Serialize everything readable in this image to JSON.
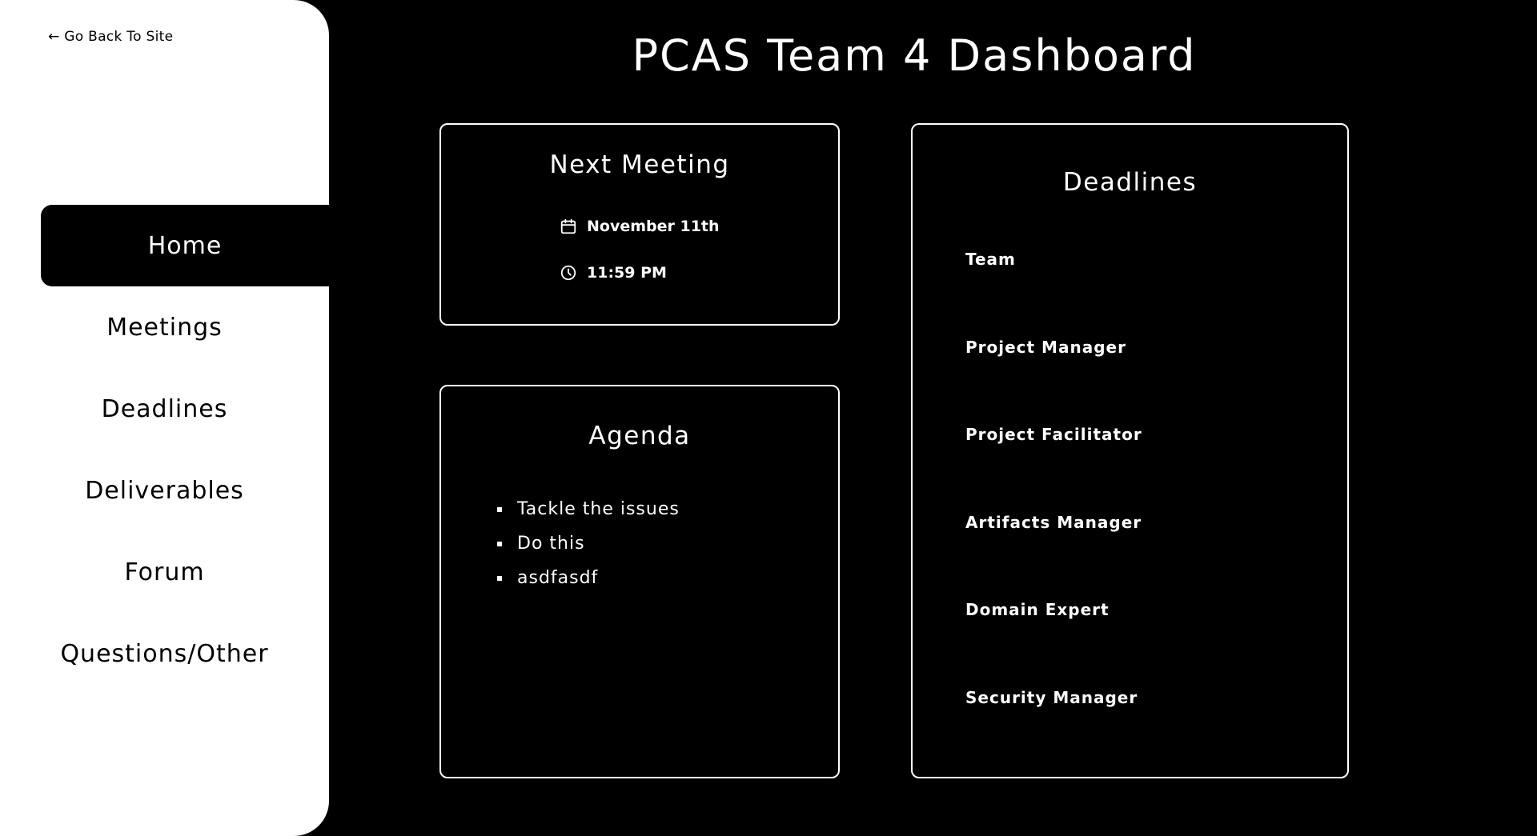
{
  "sidebar": {
    "back_link": "← Go Back To Site",
    "items": [
      {
        "label": "Home",
        "active": true
      },
      {
        "label": "Meetings"
      },
      {
        "label": "Deadlines"
      },
      {
        "label": "Deliverables"
      },
      {
        "label": "Forum"
      },
      {
        "label": "Questions/Other"
      }
    ]
  },
  "header": {
    "title": "PCAS Team 4 Dashboard"
  },
  "next_meeting": {
    "title": "Next Meeting",
    "date": "November 11th",
    "date_icon": "calendar-icon",
    "time": "11:59 PM",
    "time_icon": "clock-icon"
  },
  "agenda": {
    "title": "Agenda",
    "items": [
      "Tackle the issues",
      "Do this",
      "asdfasdf"
    ]
  },
  "deadlines": {
    "title": "Deadlines",
    "items": [
      "Team",
      "Project Manager",
      "Project Facilitator",
      "Artifacts Manager",
      "Domain Expert",
      "Security Manager"
    ]
  }
}
